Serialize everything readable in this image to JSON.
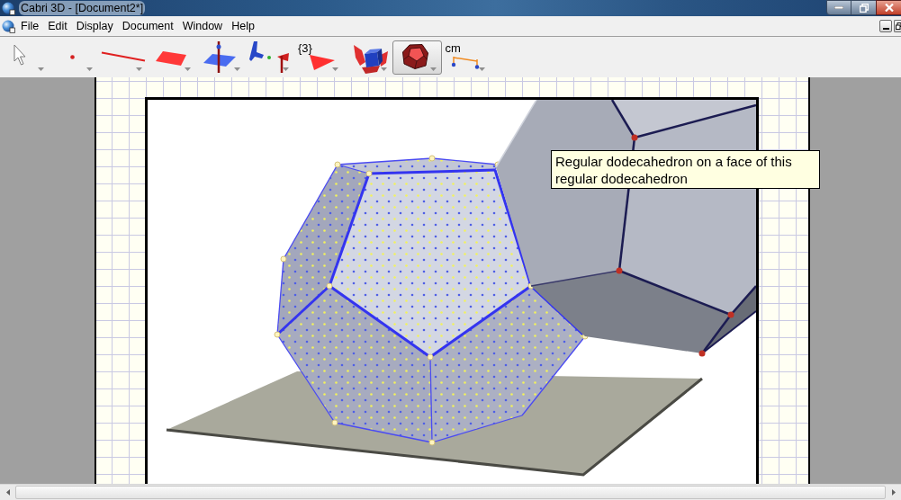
{
  "window": {
    "title": "Cabri 3D - [Document2*]"
  },
  "menu": [
    "File",
    "Edit",
    "Display",
    "Document",
    "Window",
    "Help"
  ],
  "toolbar": [
    {
      "kind": "pointer",
      "selected": false
    },
    {
      "kind": "point",
      "selected": false
    },
    {
      "kind": "line",
      "selected": false
    },
    {
      "kind": "plane",
      "selected": false
    },
    {
      "kind": "perpendicular",
      "selected": false
    },
    {
      "kind": "transform",
      "selected": false
    },
    {
      "kind": "regular-polygon",
      "label": "{3}",
      "selected": false
    },
    {
      "kind": "net",
      "selected": false
    },
    {
      "kind": "polyhedron",
      "selected": true
    },
    {
      "kind": "measure",
      "label": "cm",
      "selected": false
    }
  ],
  "tooltip": {
    "text": "Regular dodecahedron on a face of this regular dodecahedron"
  }
}
